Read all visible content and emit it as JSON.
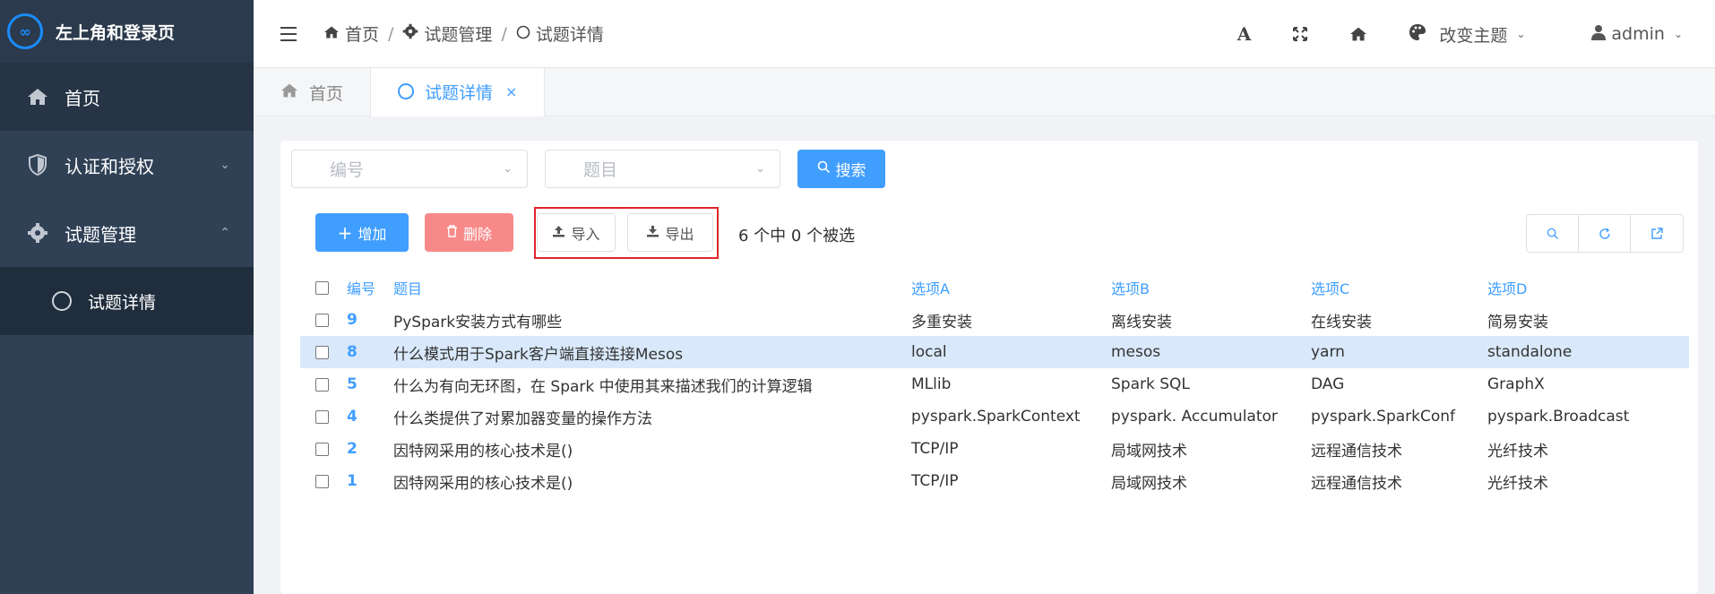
{
  "app": {
    "logo_mark": "∞",
    "title": "左上角和登录页"
  },
  "sidebar": {
    "items": [
      {
        "label": "首页",
        "icon": "home-icon"
      },
      {
        "label": "认证和授权",
        "icon": "shield-icon"
      },
      {
        "label": "试题管理",
        "icon": "gear-icon"
      }
    ],
    "sub_items": [
      {
        "label": "试题详情",
        "icon": "circle-icon"
      }
    ]
  },
  "header": {
    "breadcrumb": [
      "首页",
      "试题管理",
      "试题详情"
    ],
    "font_size_glyph": "A",
    "theme_label": "改变主题",
    "user_name": "admin"
  },
  "tabs": [
    {
      "label": "首页",
      "active": false
    },
    {
      "label": "试题详情",
      "active": true,
      "close": "×"
    }
  ],
  "filters": {
    "id_placeholder": "编号",
    "title_placeholder": "题目",
    "search_label": "搜索"
  },
  "toolbar": {
    "add_label": "增加",
    "delete_label": "删除",
    "import_label": "导入",
    "export_label": "导出",
    "selection_text": "6 个中 0 个被选"
  },
  "table": {
    "columns": [
      "编号",
      "题目",
      "选项A",
      "选项B",
      "选项C",
      "选项D"
    ],
    "rows": [
      {
        "id": "9",
        "title": "PySpark安装方式有哪些",
        "a": "多重安装",
        "b": "离线安装",
        "c": "在线安装",
        "d": "简易安装"
      },
      {
        "id": "8",
        "title": "什么模式用于Spark客户端直接连接Mesos",
        "a": "local",
        "b": "mesos",
        "c": "yarn",
        "d": "standalone"
      },
      {
        "id": "5",
        "title": "什么为有向无环图，在 Spark 中使用其来描述我们的计算逻辑",
        "a": "MLlib",
        "b": "Spark SQL",
        "c": "DAG",
        "d": "GraphX"
      },
      {
        "id": "4",
        "title": "什么类提供了对累加器变量的操作方法",
        "a": "pyspark.SparkContext",
        "b": "pyspark. Accumulator",
        "c": "pyspark.SparkConf",
        "d": "pyspark.Broadcast"
      },
      {
        "id": "2",
        "title": "因特网采用的核心技术是()",
        "a": "TCP/IP",
        "b": "局域网技术",
        "c": "远程通信技术",
        "d": "光纤技术"
      },
      {
        "id": "1",
        "title": "因特网采用的核心技术是()",
        "a": "TCP/IP",
        "b": "局域网技术",
        "c": "远程通信技术",
        "d": "光纤技术"
      }
    ]
  },
  "colors": {
    "primary": "#409eff",
    "danger": "#f78989",
    "sidebar": "#304156",
    "highlight": "#e0242b"
  }
}
